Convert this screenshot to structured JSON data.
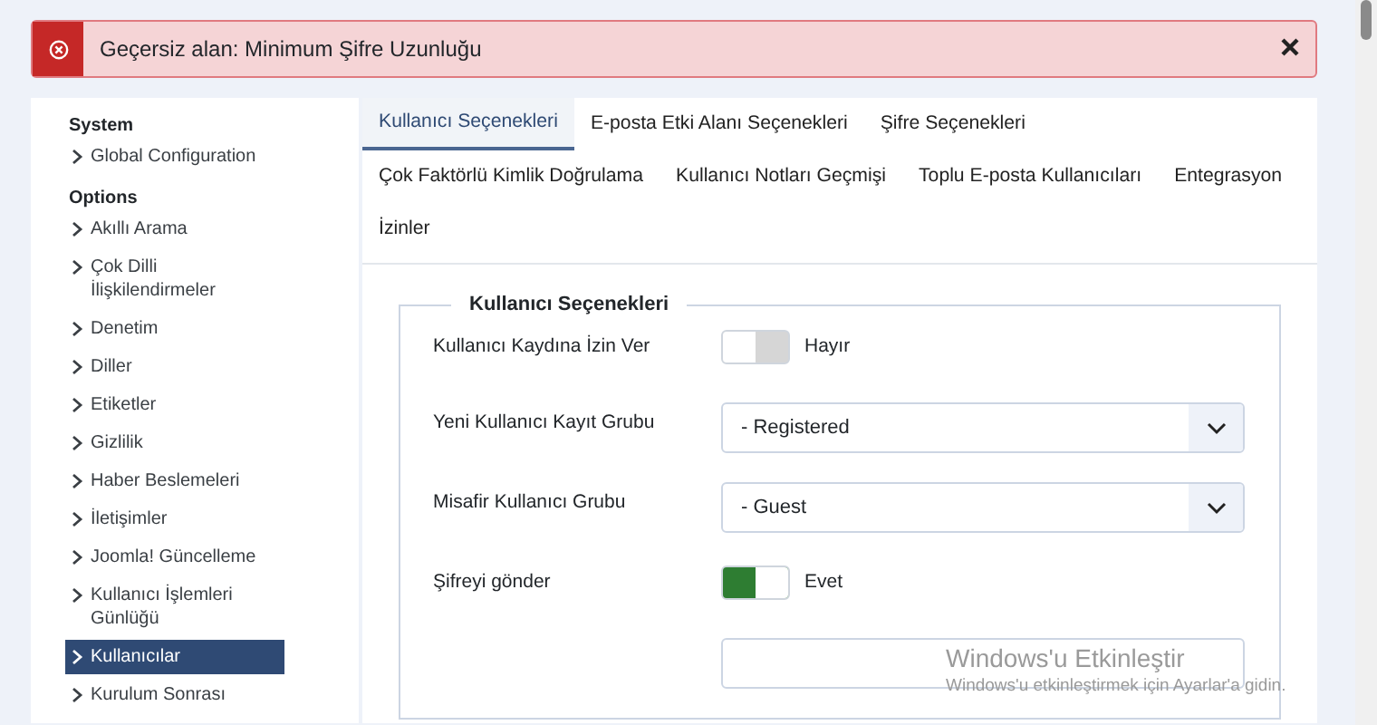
{
  "alert": {
    "kind": "error",
    "message": "Geçersiz alan: Minimum Şifre Uzunluğu"
  },
  "sidebar": {
    "sections": [
      {
        "title": "System",
        "items": [
          {
            "label": "Global Configuration",
            "selected": false
          }
        ]
      },
      {
        "title": "Options",
        "items": [
          {
            "label": "Akıllı Arama",
            "selected": false
          },
          {
            "label": "Çok Dilli İlişkilendirmeler",
            "selected": false
          },
          {
            "label": "Denetim",
            "selected": false
          },
          {
            "label": "Diller",
            "selected": false
          },
          {
            "label": "Etiketler",
            "selected": false
          },
          {
            "label": "Gizlilik",
            "selected": false
          },
          {
            "label": "Haber Beslemeleri",
            "selected": false
          },
          {
            "label": "İletişimler",
            "selected": false
          },
          {
            "label": "Joomla! Güncelleme",
            "selected": false
          },
          {
            "label": "Kullanıcı İşlemleri Günlüğü",
            "selected": false
          },
          {
            "label": "Kullanıcılar",
            "selected": true
          },
          {
            "label": "Kurulum Sonrası",
            "selected": false
          }
        ]
      }
    ]
  },
  "tab_rows": [
    [
      {
        "label": "Kullanıcı Seçenekleri",
        "selected": true
      },
      {
        "label": "E-posta Etki Alanı Seçenekleri",
        "selected": false
      },
      {
        "label": "Şifre Seçenekleri",
        "selected": false
      }
    ],
    [
      {
        "label": "Çok Faktörlü Kimlik Doğrulama",
        "selected": false
      },
      {
        "label": "Kullanıcı Notları Geçmişi",
        "selected": false
      },
      {
        "label": "Toplu E-posta Kullanıcıları",
        "selected": false
      },
      {
        "label": "Entegrasyon",
        "selected": false
      }
    ],
    [
      {
        "label": "İzinler",
        "selected": false
      }
    ]
  ],
  "fieldset": {
    "legend": "Kullanıcı Seçenekleri",
    "fields": [
      {
        "kind": "toggle",
        "label": "Kullanıcı Kaydına İzin Ver",
        "on": false,
        "value_label": "Hayır"
      },
      {
        "kind": "select",
        "label": "Yeni Kullanıcı Kayıt Grubu",
        "value": "- Registered"
      },
      {
        "kind": "select",
        "label": "Misafir Kullanıcı Grubu",
        "value": "- Guest"
      },
      {
        "kind": "toggle",
        "label": "Şifreyi gönder",
        "on": true,
        "value_label": "Evet"
      },
      {
        "kind": "select_cut"
      }
    ]
  },
  "os_notice": {
    "title": "Windows'u Etkinleştir",
    "text": "Windows'u etkinleştirmek için Ayarlar'a gidin."
  }
}
